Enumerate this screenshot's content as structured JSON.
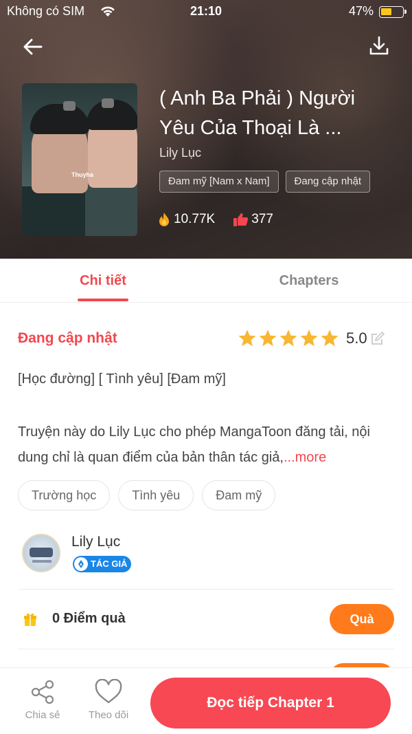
{
  "status_bar": {
    "carrier": "Không có SIM",
    "time": "21:10",
    "battery": "47%"
  },
  "header": {
    "title": "( Anh Ba Phải ) Người Yêu Của Thoại Là ...",
    "author": "Lily Lục",
    "tags": [
      "Đam mỹ [Nam x Nam]",
      "Đang cập nhật"
    ],
    "views": "10.77K",
    "likes": "377",
    "cover_text": "Thuyha"
  },
  "tabs": {
    "detail": "Chi tiết",
    "chapters": "Chapters"
  },
  "detail": {
    "status": "Đang cập nhật",
    "rating": "5.0",
    "rating_stars": 5,
    "genres_line": "[Học đường] [ Tình yêu] [Đam mỹ]",
    "description": "Truyện này do Lily Lục cho phép MangaToon đăng tải, nội dung chỉ là quan điểm của bản thân tác giả,",
    "more": "...more",
    "chips": [
      "Trường học",
      "Tình yêu",
      "Đam mỹ"
    ]
  },
  "author": {
    "name": "Lily Lục",
    "badge": "TÁC GIẢ"
  },
  "points": {
    "text": "0 Điểm quà",
    "button": "Quà"
  },
  "bottom": {
    "share": "Chia sẻ",
    "follow": "Theo dõi",
    "read": "Đọc tiếp Chapter 1"
  },
  "colors": {
    "accent": "#f2474f",
    "orange": "#ff7a1a",
    "star": "#f7b733",
    "badge_blue": "#1a86e6"
  }
}
